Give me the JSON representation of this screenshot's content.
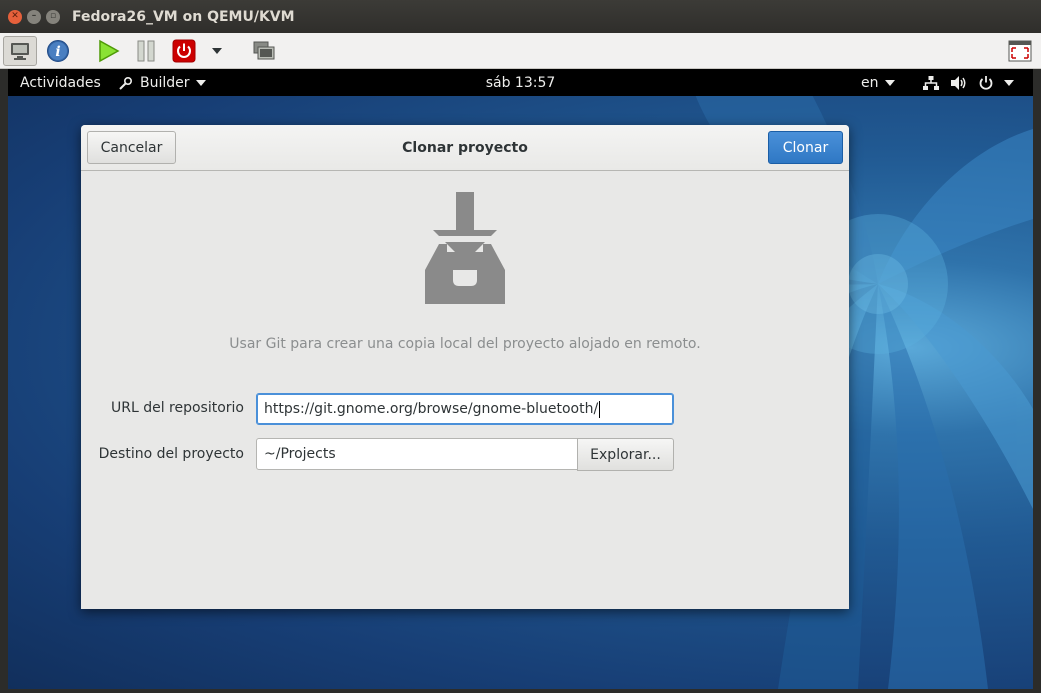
{
  "host_window": {
    "title": "Fedora26_VM on QEMU/KVM",
    "controls": [
      "close-icon",
      "minimize-icon",
      "maximize-icon"
    ],
    "toolbar": {
      "items": [
        "console-icon",
        "details-icon",
        "run-icon",
        "pause-icon",
        "shutdown-icon",
        "shutdown-menu-chevron-icon",
        "snapshots-icon",
        "fullscreen-icon"
      ],
      "colors": {
        "run": "#4e9a06",
        "shutdown": "#cc0000",
        "details": "#3465a4"
      }
    }
  },
  "gnome_topbar": {
    "activities": "Actividades",
    "app_menu": "Builder",
    "clock": "sáb 13:57",
    "input_source": "en",
    "status_icons": [
      "network-icon",
      "volume-icon",
      "power-icon",
      "chevron-down-icon"
    ]
  },
  "dialog": {
    "title": "Clonar proyecto",
    "cancel_label": "Cancelar",
    "clone_label": "Clonar",
    "icon": "download-to-tray-icon",
    "description": "Usar Git para crear una copia local del proyecto alojado en remoto.",
    "url_label": "URL del repositorio",
    "url_value": "https://git.gnome.org/browse/gnome-bluetooth/",
    "dest_label": "Destino del proyecto",
    "dest_value": "~/Projects",
    "browse_label": "Explorar...",
    "accent_color": "#4a90d9"
  }
}
